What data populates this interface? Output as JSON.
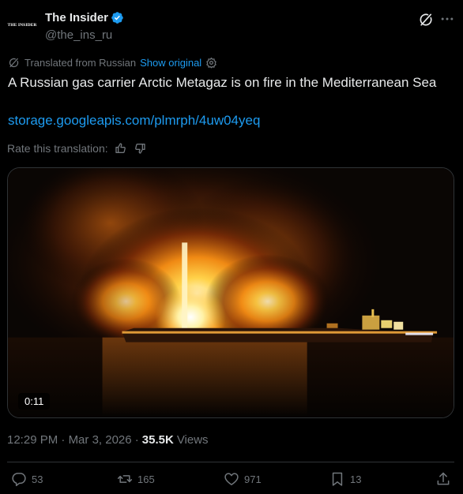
{
  "author": {
    "name": "The Insider",
    "handle": "@the_ins_ru",
    "avatar_text": "THE INSIDER",
    "verified": true
  },
  "translation": {
    "notice": "Translated from Russian",
    "show_original": "Show original"
  },
  "tweet": {
    "text": "A Russian gas carrier Arctic Metagaz is on fire in the Mediterranean Sea",
    "link": "storage.googleapis.com/plmrph/4uw04yeq"
  },
  "rate": {
    "label": "Rate this translation:"
  },
  "media": {
    "duration": "0:11"
  },
  "meta": {
    "time": "12:29 PM",
    "date": "Mar 3, 2026",
    "sep1": "·",
    "sep2": "·",
    "views_count": "35.5K",
    "views_label": "Views"
  },
  "actions": {
    "replies": "53",
    "reposts": "165",
    "likes": "971",
    "bookmarks": "13"
  },
  "colors": {
    "accent": "#1d9bf0",
    "muted": "#71767b",
    "text": "#e7e9ea"
  }
}
